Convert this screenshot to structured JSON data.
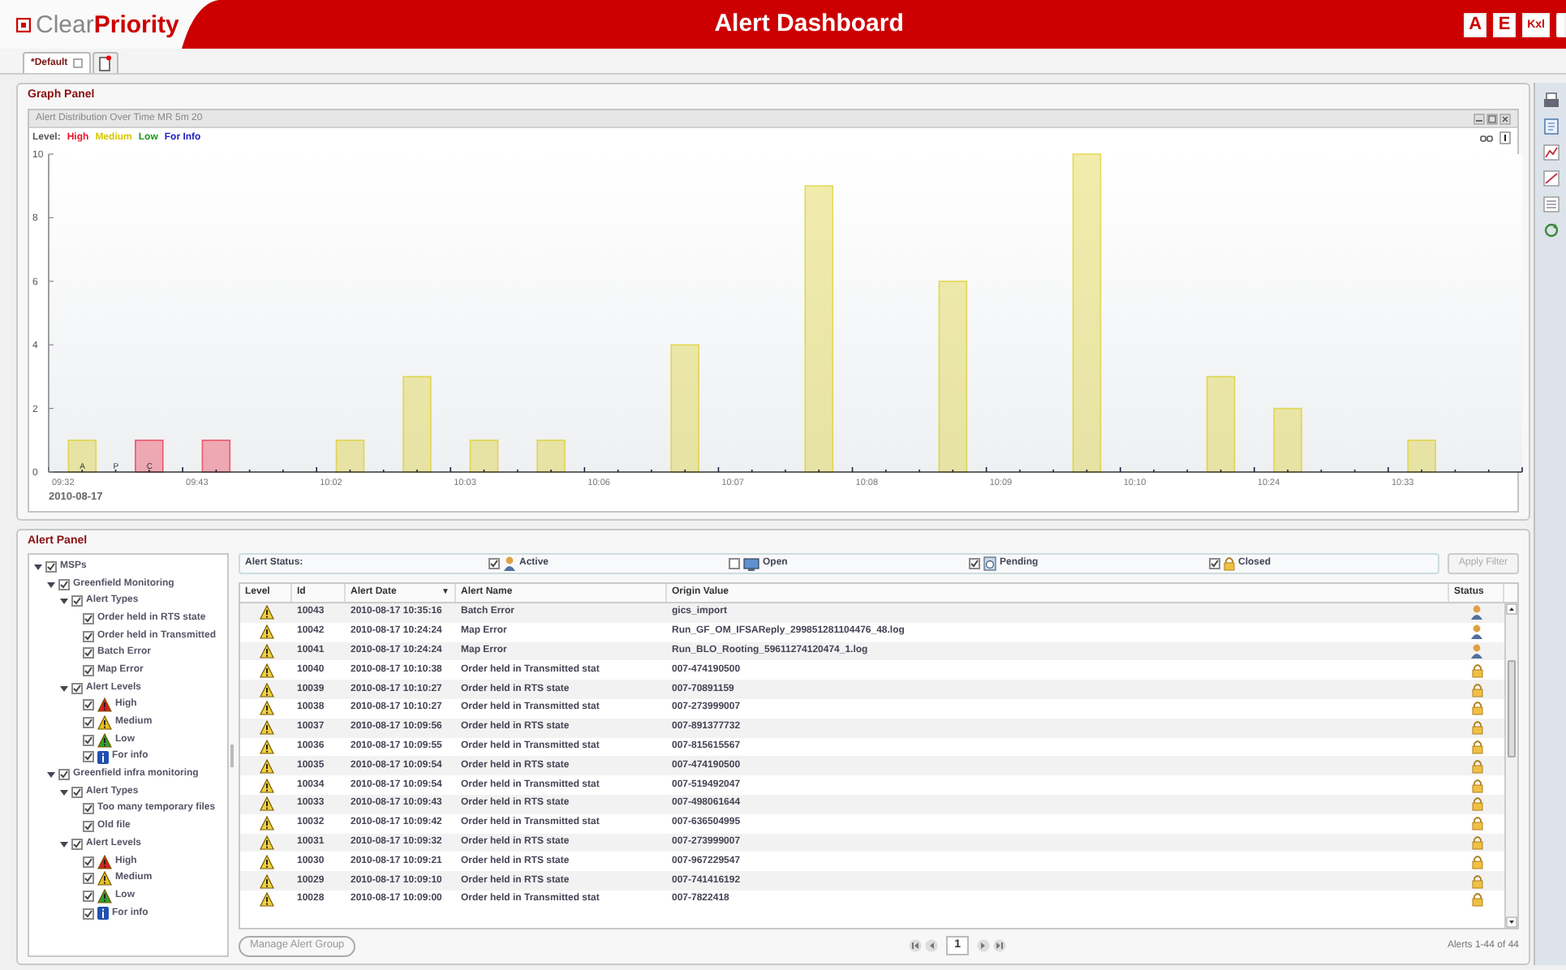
{
  "header": {
    "logo_plain": "Clear",
    "logo_bold": "Priority",
    "title": "Alert Dashboard",
    "buttons": [
      "A",
      "E",
      "Kxl"
    ]
  },
  "tabs": [
    {
      "label": "*Default",
      "selected": true
    }
  ],
  "graph_panel": {
    "title": "Graph Panel",
    "chart_window": {
      "title": "Alert Distribution Over Time MR 5m 20",
      "legend_label": "Level:",
      "date": "2010-08-17",
      "chart_data": {
        "type": "bar",
        "categories": [
          "09:32",
          null,
          "09:43",
          null,
          "10:02",
          null,
          "10:03",
          null,
          "10:06",
          null,
          "10:07",
          null,
          "10:08",
          null,
          "10:09",
          null,
          "10:10",
          null,
          "10:24",
          null,
          "10:33",
          null
        ],
        "series": [
          {
            "name": "High",
            "color": "#e8102a",
            "values": [
              null,
              1,
              1,
              null,
              null,
              null,
              null,
              null,
              null,
              null,
              null,
              null,
              null,
              null,
              null,
              null,
              null,
              null,
              null,
              null,
              null,
              null
            ]
          },
          {
            "name": "Medium",
            "color": "#d8c800",
            "values": [
              1,
              null,
              null,
              null,
              1,
              3,
              1,
              1,
              null,
              4,
              null,
              9,
              null,
              6,
              null,
              10,
              null,
              3,
              2,
              null,
              1,
              null
            ]
          },
          {
            "name": "Low",
            "color": "#1a9a1a",
            "values": [
              null,
              null,
              null,
              null,
              null,
              null,
              null,
              null,
              null,
              null,
              null,
              null,
              null,
              null,
              null,
              null,
              null,
              null,
              null,
              null,
              null,
              null
            ]
          },
          {
            "name": "For Info",
            "color": "#2020c0",
            "values": [
              null,
              null,
              null,
              null,
              null,
              null,
              null,
              null,
              null,
              null,
              null,
              null,
              null,
              null,
              null,
              null,
              null,
              null,
              null,
              null,
              null,
              null
            ]
          }
        ],
        "ylim": [
          0,
          10
        ],
        "yticks": [
          0,
          2,
          4,
          6,
          8,
          10
        ],
        "annotations": [
          "A",
          "P",
          "C"
        ]
      }
    }
  },
  "alert_panel": {
    "title": "Alert Panel",
    "tree": [
      {
        "label": "MSPs",
        "checked": true,
        "expanded": true,
        "children": [
          {
            "label": "Greenfield Monitoring",
            "checked": true,
            "expanded": true,
            "children": [
              {
                "label": "Alert Types",
                "checked": true,
                "expanded": true,
                "children": [
                  {
                    "label": "Order held in RTS state",
                    "checked": true
                  },
                  {
                    "label": "Order held in Transmitted",
                    "checked": true
                  },
                  {
                    "label": "Batch Error",
                    "checked": true
                  },
                  {
                    "label": "Map Error",
                    "checked": true
                  }
                ]
              },
              {
                "label": "Alert Levels",
                "checked": true,
                "expanded": true,
                "children": [
                  {
                    "label": "High",
                    "checked": true,
                    "kind": "warning",
                    "color": "#d42020"
                  },
                  {
                    "label": "Medium",
                    "checked": true,
                    "kind": "warning",
                    "color": "#e8c020"
                  },
                  {
                    "label": "Low",
                    "checked": true,
                    "kind": "warning",
                    "color": "#30a030"
                  },
                  {
                    "label": "For info",
                    "checked": true,
                    "kind": "info",
                    "color": "#2050b0"
                  }
                ]
              }
            ]
          },
          {
            "label": "Greenfield infra monitoring",
            "checked": true,
            "expanded": true,
            "children": [
              {
                "label": "Alert Types",
                "checked": true,
                "expanded": true,
                "children": [
                  {
                    "label": "Too many temporary files",
                    "checked": true
                  },
                  {
                    "label": "Old file",
                    "checked": true
                  }
                ]
              },
              {
                "label": "Alert Levels",
                "checked": true,
                "expanded": true,
                "children": [
                  {
                    "label": "High",
                    "checked": true,
                    "kind": "warning",
                    "color": "#d42020"
                  },
                  {
                    "label": "Medium",
                    "checked": true,
                    "kind": "warning",
                    "color": "#e8c020"
                  },
                  {
                    "label": "Low",
                    "checked": true,
                    "kind": "warning",
                    "color": "#30a030"
                  },
                  {
                    "label": "For info",
                    "checked": true,
                    "kind": "info",
                    "color": "#2050b0"
                  }
                ]
              }
            ]
          }
        ]
      }
    ],
    "status_filter": {
      "label": "Alert Status:",
      "options": [
        {
          "label": "Active",
          "checked": true,
          "kind": "active"
        },
        {
          "label": "Open",
          "checked": false,
          "kind": "open"
        },
        {
          "label": "Pending",
          "checked": true,
          "kind": "pending"
        },
        {
          "label": "Closed",
          "checked": true,
          "kind": "closed"
        }
      ],
      "apply_button": "Apply Filter"
    },
    "table": {
      "columns": [
        "Level",
        "Id",
        "Alert Date",
        "Alert Name",
        "Origin Value",
        "Status"
      ],
      "sort_indicator": "▼",
      "rows": [
        {
          "kind": "active",
          "id": "10043",
          "date": "2010-08-17 10:35:16",
          "name": "Batch Error",
          "origin": "gics_import"
        },
        {
          "kind": "active",
          "id": "10042",
          "date": "2010-08-17 10:24:24",
          "name": "Map Error",
          "origin": "Run_GF_OM_IFSAReply_299851281104476_48.log"
        },
        {
          "kind": "active",
          "id": "10041",
          "date": "2010-08-17 10:24:24",
          "name": "Map Error",
          "origin": "Run_BLO_Rooting_59611274120474_1.log"
        },
        {
          "kind": "closed",
          "id": "10040",
          "date": "2010-08-17 10:10:38",
          "name": "Order held in Transmitted stat",
          "origin": "007-474190500"
        },
        {
          "kind": "closed",
          "id": "10039",
          "date": "2010-08-17 10:10:27",
          "name": "Order held in RTS state",
          "origin": "007-70891159"
        },
        {
          "kind": "closed",
          "id": "10038",
          "date": "2010-08-17 10:10:27",
          "name": "Order held in Transmitted stat",
          "origin": "007-273999007"
        },
        {
          "kind": "closed",
          "id": "10037",
          "date": "2010-08-17 10:09:56",
          "name": "Order held in RTS state",
          "origin": "007-891377732"
        },
        {
          "kind": "closed",
          "id": "10036",
          "date": "2010-08-17 10:09:55",
          "name": "Order held in Transmitted stat",
          "origin": "007-815615567"
        },
        {
          "kind": "closed",
          "id": "10035",
          "date": "2010-08-17 10:09:54",
          "name": "Order held in RTS state",
          "origin": "007-474190500"
        },
        {
          "kind": "closed",
          "id": "10034",
          "date": "2010-08-17 10:09:54",
          "name": "Order held in Transmitted stat",
          "origin": "007-519492047"
        },
        {
          "kind": "closed",
          "id": "10033",
          "date": "2010-08-17 10:09:43",
          "name": "Order held in RTS state",
          "origin": "007-498061644"
        },
        {
          "kind": "closed",
          "id": "10032",
          "date": "2010-08-17 10:09:42",
          "name": "Order held in Transmitted stat",
          "origin": "007-636504995"
        },
        {
          "kind": "closed",
          "id": "10031",
          "date": "2010-08-17 10:09:32",
          "name": "Order held in RTS state",
          "origin": "007-273999007"
        },
        {
          "kind": "closed",
          "id": "10030",
          "date": "2010-08-17 10:09:21",
          "name": "Order held in RTS state",
          "origin": "007-967229547"
        },
        {
          "kind": "closed",
          "id": "10029",
          "date": "2010-08-17 10:09:10",
          "name": "Order held in RTS state",
          "origin": "007-741416192"
        },
        {
          "kind": "closed",
          "id": "10028",
          "date": "2010-08-17 10:09:00",
          "name": "Order held in Transmitted stat",
          "origin": "007-7822418"
        }
      ]
    },
    "manage_button": "Manage Alert Group",
    "pager": {
      "page": "1"
    },
    "summary": "Alerts 1-44 of 44"
  }
}
